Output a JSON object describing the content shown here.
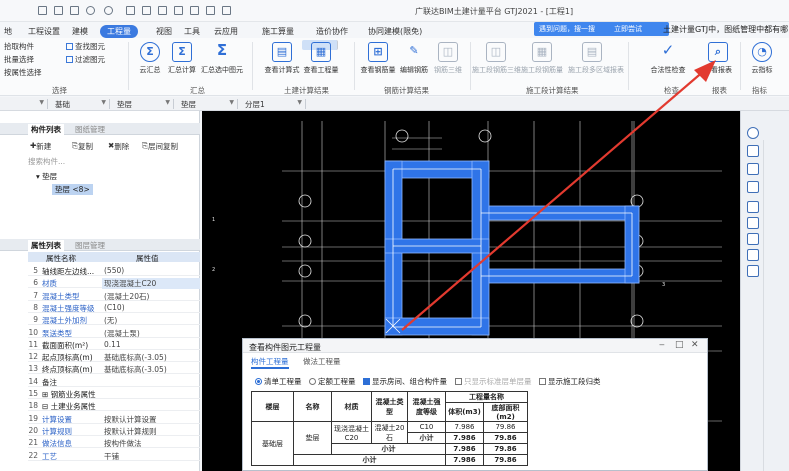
{
  "window": {
    "title": "广联达BIM土建计量平台 GTJ2021 - [工程1]",
    "notify": {
      "text": "遇到问题，搜一搜",
      "button": "立即尝试"
    },
    "banner": "土建计量GTJ中，图纸管理中都有哪"
  },
  "menu": {
    "tabs": [
      "地",
      "工程设置",
      "建模",
      "工程量",
      "视图",
      "工具",
      "云应用",
      "施工算量",
      "造价协作",
      "协同建模(限免)"
    ],
    "active": "工程量"
  },
  "ribbon": {
    "select_group": {
      "items": [
        "拾取构件",
        "批量选择",
        "按属性选择"
      ],
      "label": "选择"
    },
    "tools_group": {
      "items": [
        "查找图元",
        "过滤图元"
      ]
    },
    "summary": {
      "buttons": [
        "云汇总",
        "汇总计算",
        "汇总选中图元"
      ],
      "label": "汇总"
    },
    "result": {
      "buttons": [
        "查看计算式",
        "查看工程量"
      ],
      "label": "土建计算结果"
    },
    "rebar": {
      "buttons": [
        "查看钢筋量",
        "编辑钢筋",
        "钢筋三维"
      ],
      "label": "钢筋计算结果"
    },
    "construction": {
      "buttons": [
        "施工段钢筋三维",
        "施工段钢筋量",
        "施工段多区域报表"
      ],
      "label": "施工段计算结果"
    },
    "check": {
      "buttons": [
        "合法性检查"
      ],
      "label": "检查"
    },
    "report": {
      "buttons": [
        "查看报表"
      ],
      "label": "报表"
    },
    "index": {
      "buttons": [
        "云指标"
      ],
      "label": "指标"
    }
  },
  "selector_bar": {
    "values": [
      "",
      "基础",
      "垫层",
      "垫层",
      "分层1"
    ]
  },
  "component_panel": {
    "tabs": [
      "构件列表",
      "图纸管理"
    ],
    "tools": [
      "新建",
      "复制",
      "删除",
      "层间复制"
    ],
    "search_placeholder": "搜索构件...",
    "category": "垫层",
    "item": "垫层 <8>"
  },
  "property_panel": {
    "tabs": [
      "属性列表",
      "图层管理"
    ],
    "headers": [
      "属性名称",
      "属性值"
    ],
    "rows": [
      {
        "num": "5",
        "name": "轴线距左边线...",
        "value": "(550)"
      },
      {
        "num": "6",
        "name": "材质",
        "value": "现浇混凝土C20"
      },
      {
        "num": "7",
        "name": "混凝土类型",
        "value": "(混凝土20石)"
      },
      {
        "num": "8",
        "name": "混凝土强度等级",
        "value": "(C10)"
      },
      {
        "num": "9",
        "name": "混凝土外加剂",
        "value": "(无)"
      },
      {
        "num": "10",
        "name": "泵送类型",
        "value": "(混凝土泵)"
      },
      {
        "num": "11",
        "name": "截面面积(m²)",
        "value": "0.11"
      },
      {
        "num": "12",
        "name": "起点顶标高(m)",
        "value": "基础底标高(-3.05)"
      },
      {
        "num": "13",
        "name": "终点顶标高(m)",
        "value": "基础底标高(-3.05)"
      },
      {
        "num": "14",
        "name": "备注",
        "value": ""
      },
      {
        "num": "15",
        "name": "⊞ 钢筋业务属性",
        "value": ""
      },
      {
        "num": "18",
        "name": "⊟ 土建业务属性",
        "value": ""
      },
      {
        "num": "19",
        "name": "计算设置",
        "value": "按默认计算设置"
      },
      {
        "num": "20",
        "name": "计算规则",
        "value": "按默认计算规则"
      },
      {
        "num": "21",
        "name": "做法信息",
        "value": "按构件做法"
      },
      {
        "num": "22",
        "name": "工艺",
        "value": "干铺"
      }
    ]
  },
  "dialog": {
    "title": "查看构件图元工程量",
    "tabs": [
      "构件工程量",
      "做法工程量"
    ],
    "options": [
      "清单工程量",
      "定额工程量",
      "显示房间、组合构件量",
      "只显示标准层单层量",
      "显示施工段归类"
    ],
    "table": {
      "headers": [
        "楼层",
        "名称",
        "材质",
        "混凝土类型",
        "混凝土强度等级",
        "工程量名称",
        "体积(m3)",
        "底部面积(m2)"
      ],
      "floor": "基础层",
      "name": "垫层",
      "material": "现浇混凝土C20",
      "concrete_type": "混凝土20石",
      "grade": "C10",
      "rows": [
        {
          "label": "",
          "volume": "7.986",
          "area": "79.86"
        },
        {
          "label": "小计",
          "volume": "7.986",
          "area": "79.86"
        },
        {
          "label": "小计",
          "volume": "7.986",
          "area": "79.86"
        },
        {
          "label": "小计",
          "volume": "7.986",
          "area": "79.86"
        }
      ]
    }
  },
  "colors": {
    "accent": "#3b7ae0",
    "canvas": "#000000",
    "footing_fill": "#2f74e8",
    "annotation_arrow": "#e23a2f"
  }
}
